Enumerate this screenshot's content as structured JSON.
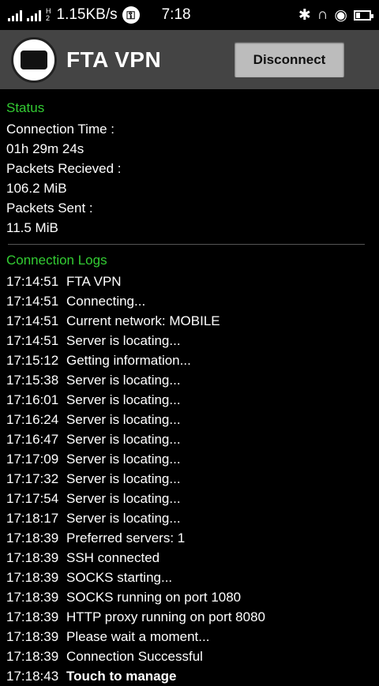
{
  "statusbar": {
    "speed": "1.15KB/s",
    "time": "7:18",
    "vpn_key": "⚿"
  },
  "header": {
    "title": "FTA VPN",
    "disconnect_label": "Disconnect"
  },
  "status": {
    "title": "Status",
    "connection_time_label": "Connection Time :",
    "connection_time_value": "01h 29m 24s",
    "packets_received_label": "Packets Recieved :",
    "packets_received_value": "106.2 MiB",
    "packets_sent_label": "Packets Sent :",
    "packets_sent_value": "11.5 MiB"
  },
  "logs": {
    "title": "Connection Logs",
    "entries": [
      {
        "time": "17:14:51",
        "message": "FTA VPN"
      },
      {
        "time": "17:14:51",
        "message": "Connecting..."
      },
      {
        "time": "17:14:51",
        "message": "Current network: MOBILE"
      },
      {
        "time": "17:14:51",
        "message": "Server is locating..."
      },
      {
        "time": "17:15:12",
        "message": "Getting information..."
      },
      {
        "time": "17:15:38",
        "message": "Server is locating..."
      },
      {
        "time": "17:16:01",
        "message": "Server is locating..."
      },
      {
        "time": "17:16:24",
        "message": "Server is locating..."
      },
      {
        "time": "17:16:47",
        "message": "Server is locating..."
      },
      {
        "time": "17:17:09",
        "message": "Server is locating..."
      },
      {
        "time": "17:17:32",
        "message": "Server is locating..."
      },
      {
        "time": "17:17:54",
        "message": "Server is locating..."
      },
      {
        "time": "17:18:17",
        "message": "Server is locating..."
      },
      {
        "time": "17:18:39",
        "message": "Preferred servers: 1"
      },
      {
        "time": "17:18:39",
        "message": "SSH connected"
      },
      {
        "time": "17:18:39",
        "message": "SOCKS starting..."
      },
      {
        "time": "17:18:39",
        "message": "SOCKS running on port 1080"
      },
      {
        "time": "17:18:39",
        "message": "HTTP proxy running on port 8080"
      },
      {
        "time": "17:18:39",
        "message": "Please wait a moment..."
      },
      {
        "time": "17:18:39",
        "message": "Connection Successful"
      },
      {
        "time": "17:18:43",
        "message": "Touch to manage"
      }
    ]
  },
  "colors": {
    "accent_green": "#33cc33",
    "header_bg": "#444444",
    "button_bg": "#bcbcbc"
  }
}
